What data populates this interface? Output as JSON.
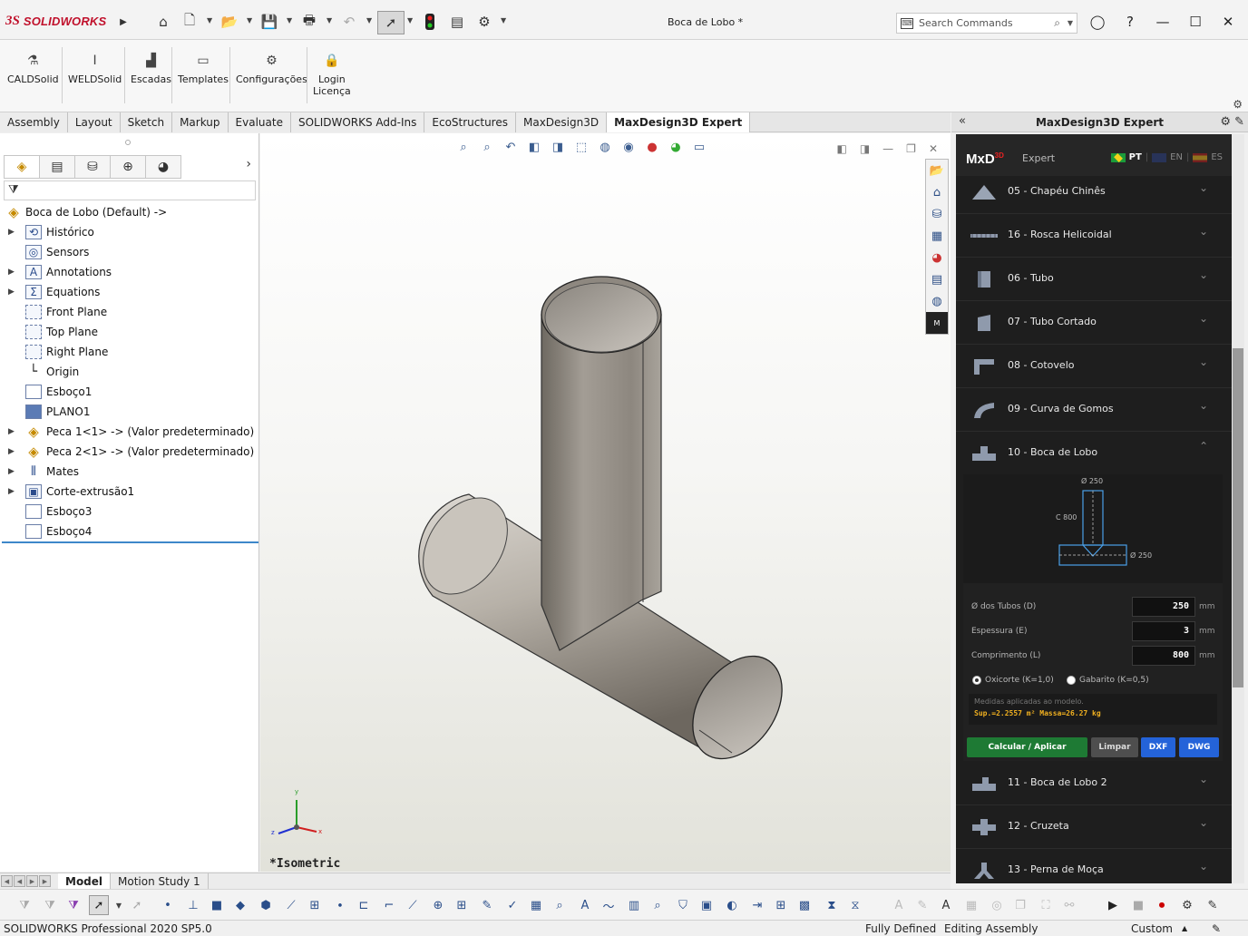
{
  "app": {
    "brand_ds": "3S",
    "brand_name": "SOLIDWORKS",
    "document_title": "Boca de Lobo *",
    "search_placeholder": "Search Commands"
  },
  "ribbon": {
    "buttons": [
      "CALDSolid",
      "WELDSolid",
      "Escadas",
      "Templates",
      "Configurações",
      "Login\nLicença"
    ]
  },
  "command_tabs": [
    "Assembly",
    "Layout",
    "Sketch",
    "Markup",
    "Evaluate",
    "SOLIDWORKS Add-Ins",
    "EcoStructures",
    "MaxDesign3D",
    "MaxDesign3D Expert"
  ],
  "active_command_tab": "MaxDesign3D Expert",
  "feature_tree": {
    "root": "Boca de Lobo  (Default) ->",
    "items": [
      "Histórico",
      "Sensors",
      "Annotations",
      "Equations",
      "Front Plane",
      "Top Plane",
      "Right Plane",
      "Origin",
      "Esboço1",
      "PLANO1",
      "Peca 1<1> -> (Valor predeterminado)",
      "Peca 2<1> -> (Valor predeterminado)",
      "Mates",
      "Corte-extrusão1",
      "Esboço3",
      "Esboço4"
    ]
  },
  "viewport": {
    "view_label": "*Isometric",
    "triad": {
      "x": "x",
      "y": "y",
      "z": "z"
    }
  },
  "maxdesign": {
    "panel_title": "MaxDesign3D Expert",
    "logo": "MxD",
    "logo_sup": "3D",
    "mode": "Expert",
    "languages": [
      "PT",
      "EN",
      "ES"
    ],
    "active_language": "PT",
    "items": [
      "05 - Chapéu Chinês",
      "16 - Rosca Helicoidal",
      "06 - Tubo",
      "07 - Tubo Cortado",
      "08 - Cotovelo",
      "09 - Curva de Gomos",
      "10 - Boca de Lobo",
      "11 - Boca de Lobo 2",
      "12 - Cruzeta",
      "13 - Perna de Moça"
    ],
    "open_item": "10 - Boca de Lobo",
    "diagram": {
      "top_label": "Ø 250",
      "side_label": "C 800",
      "bottom_label": "Ø 250"
    },
    "params": [
      {
        "label": "Ø dos Tubos (D)",
        "value": "250",
        "unit": "mm"
      },
      {
        "label": "Espessura (E)",
        "value": "3",
        "unit": "mm"
      },
      {
        "label": "Comprimento (L)",
        "value": "800",
        "unit": "mm"
      }
    ],
    "radio": [
      {
        "label": "Oxicorte (K=1,0)",
        "selected": true
      },
      {
        "label": "Gabarito (K=0,5)",
        "selected": false
      }
    ],
    "result_note": "Medidas aplicadas ao modelo.",
    "result_values": "Sup.=2.2557 m²   Massa=26.27 kg",
    "buttons": [
      "Calcular / Aplicar",
      "Limpar",
      "DXF",
      "DWG"
    ],
    "colors": {
      "green": "#1e7a34",
      "blue": "#2463d9",
      "gray": "#4e4e4e"
    }
  },
  "bottom_tabs": [
    "Model",
    "Motion Study 1"
  ],
  "active_bottom_tab": "Model",
  "status": {
    "product": "SOLIDWORKS Professional 2020 SP5.0",
    "defined": "Fully Defined",
    "mode": "Editing Assembly",
    "units": "Custom"
  }
}
